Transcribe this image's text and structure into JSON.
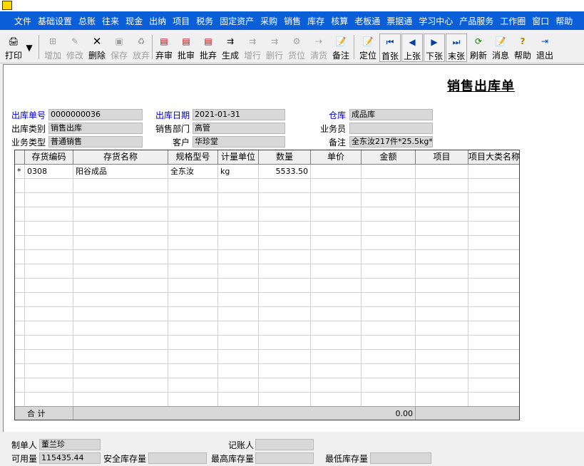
{
  "menu": [
    "文件",
    "基础设置",
    "总账",
    "往来",
    "现金",
    "出纳",
    "项目",
    "税务",
    "固定资产",
    "采购",
    "销售",
    "库存",
    "核算",
    "老板通",
    "票据通",
    "学习中心",
    "产品服务",
    "工作圈",
    "窗口",
    "帮助"
  ],
  "toolbar": {
    "print": "打印",
    "add": "增加",
    "edit": "修改",
    "delete": "删除",
    "save": "保存",
    "discard": "放弃",
    "abandon_review": "弃审",
    "approve": "批审",
    "batch_abandon": "批弃",
    "generate": "生成",
    "add_row": "增行",
    "delete_row": "删行",
    "location": "货位",
    "clear": "清货",
    "note": "备注",
    "locate": "定位",
    "first": "首张",
    "prev": "上张",
    "next": "下张",
    "last": "末张",
    "refresh": "刷新",
    "message": "消息",
    "help": "帮助",
    "exit": "退出"
  },
  "doc": {
    "title": "销售出库单",
    "labels": {
      "out_no": "出库单号",
      "out_date": "出库日期",
      "warehouse": "仓库",
      "out_type": "出库类别",
      "department": "销售部门",
      "salesman": "业务员",
      "biz_type": "业务类型",
      "customer": "客户",
      "remark": "备注"
    },
    "values": {
      "out_no": "0000000036",
      "out_date": "2021-01-31",
      "warehouse": "成品库",
      "out_type": "销售出库",
      "department": "高管",
      "salesman": "",
      "biz_type": "普通销售",
      "customer": "华珍堂",
      "remark": "全东汝217件*25.5kg*"
    }
  },
  "grid": {
    "columns": [
      "存货编码",
      "存货名称",
      "规格型号",
      "计量单位",
      "数量",
      "单价",
      "金额",
      "项目",
      "项目大类名称"
    ],
    "rows": [
      {
        "marker": "*",
        "code": "0308",
        "name": "阳谷成品",
        "spec": "全东汝",
        "unit": "kg",
        "qty": "5533.50",
        "price": "",
        "amount": "",
        "project": "",
        "project_class": ""
      }
    ],
    "sum_label": "合  计",
    "sum_amount": "0.00"
  },
  "footer": {
    "maker_label": "制单人",
    "maker": "董兰珍",
    "bookkeeper_label": "记账人",
    "bookkeeper": "",
    "available_label": "可用量",
    "available": "115435.44",
    "safety_label": "安全库存量",
    "safety": "",
    "max_label": "最高库存量",
    "max": "",
    "min_label": "最低库存量",
    "min": ""
  }
}
